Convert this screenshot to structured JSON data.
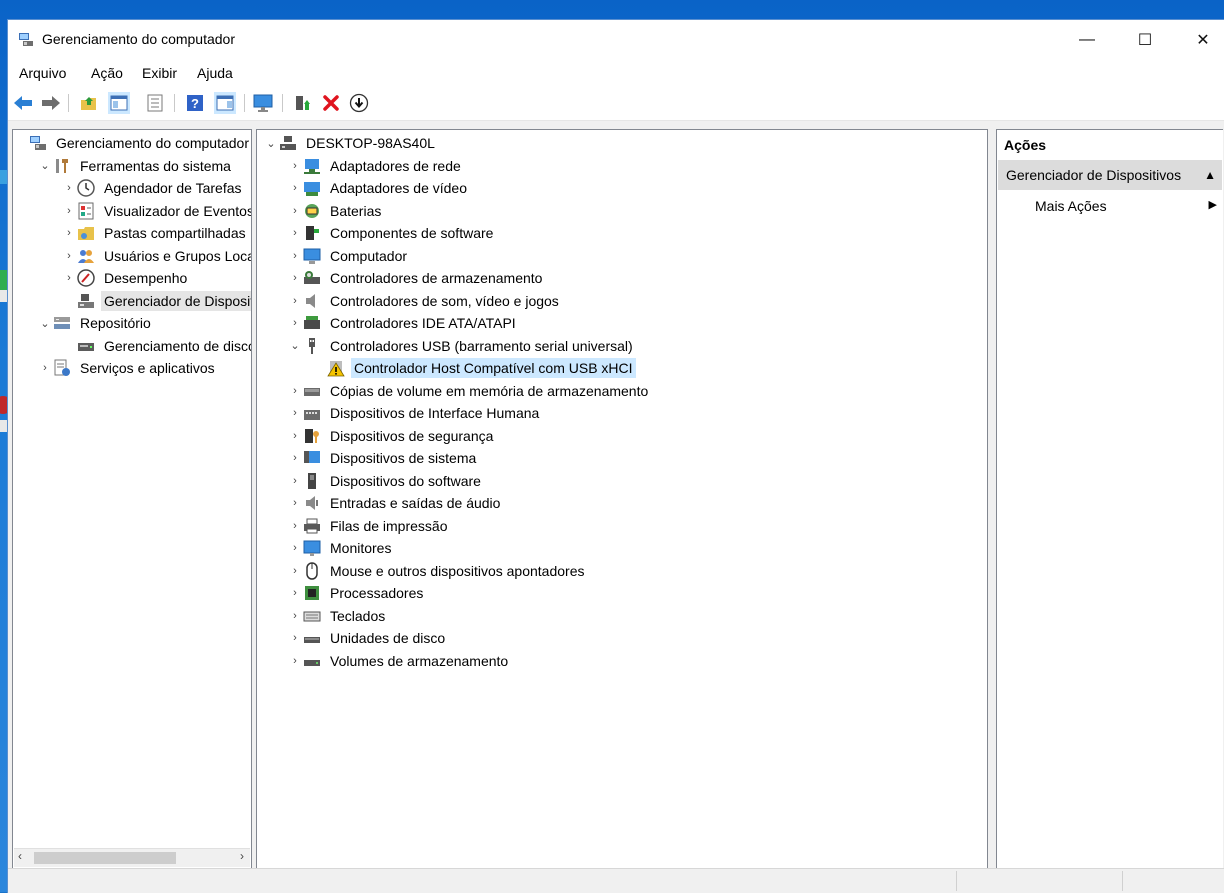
{
  "window": {
    "title": "Gerenciamento do computador",
    "controls": {
      "minimize": "—",
      "maximize": "☐",
      "close": "✕"
    }
  },
  "menu": [
    "Arquivo",
    "Ação",
    "Exibir",
    "Ajuda"
  ],
  "toolbar": [
    "back-icon",
    "forward-icon",
    "up-folder-icon",
    "show-hide-tree-icon",
    "properties-icon",
    "help-icon",
    "action-pane-icon",
    "monitor-icon",
    "enable-device-icon",
    "uninstall-icon",
    "update-driver-icon"
  ],
  "left_tree": [
    {
      "label": "Gerenciamento do computador",
      "expander": "",
      "icon": "computer-management-icon",
      "level": 0
    },
    {
      "label": "Ferramentas do sistema",
      "expander": "⌄",
      "icon": "tools-icon",
      "level": 1
    },
    {
      "label": "Agendador de Tarefas",
      "expander": "›",
      "icon": "clock-icon",
      "level": 2
    },
    {
      "label": "Visualizador de Eventos",
      "expander": "›",
      "icon": "event-viewer-icon",
      "level": 2
    },
    {
      "label": "Pastas compartilhadas",
      "expander": "›",
      "icon": "shared-folder-icon",
      "level": 2
    },
    {
      "label": "Usuários e Grupos Locai",
      "expander": "›",
      "icon": "users-icon",
      "level": 2
    },
    {
      "label": "Desempenho",
      "expander": "›",
      "icon": "performance-icon",
      "level": 2
    },
    {
      "label": "Gerenciador de Disposit",
      "expander": "",
      "icon": "device-manager-icon",
      "level": 2,
      "selected": true
    },
    {
      "label": "Repositório",
      "expander": "⌄",
      "icon": "storage-icon",
      "level": 1
    },
    {
      "label": "Gerenciamento de disco",
      "expander": "",
      "icon": "disk-management-icon",
      "level": 2
    },
    {
      "label": "Serviços e aplicativos",
      "expander": "›",
      "icon": "services-icon",
      "level": 1
    }
  ],
  "device_tree": [
    {
      "label": "DESKTOP-98AS40L",
      "expander": "⌄",
      "icon": "computer-root-icon",
      "level": 0
    },
    {
      "label": "Adaptadores de rede",
      "expander": "›",
      "icon": "network-adapter-icon",
      "level": 1
    },
    {
      "label": "Adaptadores de vídeo",
      "expander": "›",
      "icon": "display-adapter-icon",
      "level": 1
    },
    {
      "label": "Baterias",
      "expander": "›",
      "icon": "battery-icon",
      "level": 1
    },
    {
      "label": "Componentes de software",
      "expander": "›",
      "icon": "software-component-icon",
      "level": 1
    },
    {
      "label": "Computador",
      "expander": "›",
      "icon": "computer-icon",
      "level": 1
    },
    {
      "label": "Controladores de armazenamento",
      "expander": "›",
      "icon": "storage-controller-icon",
      "level": 1
    },
    {
      "label": "Controladores de som, vídeo e jogos",
      "expander": "›",
      "icon": "speaker-icon",
      "level": 1
    },
    {
      "label": "Controladores IDE ATA/ATAPI",
      "expander": "›",
      "icon": "ide-controller-icon",
      "level": 1
    },
    {
      "label": "Controladores USB (barramento serial universal)",
      "expander": "⌄",
      "icon": "usb-icon",
      "level": 1
    },
    {
      "label": "Controlador Host Compatível com USB xHCI",
      "expander": "",
      "icon": "warning-icon",
      "level": 2,
      "selected": true
    },
    {
      "label": "Cópias de volume em memória de armazenamento",
      "expander": "›",
      "icon": "drive-icon",
      "level": 1
    },
    {
      "label": "Dispositivos de Interface Humana",
      "expander": "›",
      "icon": "hid-icon",
      "level": 1
    },
    {
      "label": "Dispositivos de segurança",
      "expander": "›",
      "icon": "security-device-icon",
      "level": 1
    },
    {
      "label": "Dispositivos de sistema",
      "expander": "›",
      "icon": "system-device-icon",
      "level": 1
    },
    {
      "label": "Dispositivos do software",
      "expander": "›",
      "icon": "software-device-icon",
      "level": 1
    },
    {
      "label": "Entradas e saídas de áudio",
      "expander": "›",
      "icon": "audio-io-icon",
      "level": 1
    },
    {
      "label": "Filas de impressão",
      "expander": "›",
      "icon": "printer-icon",
      "level": 1
    },
    {
      "label": "Monitores",
      "expander": "›",
      "icon": "monitor-icon",
      "level": 1
    },
    {
      "label": "Mouse e outros dispositivos apontadores",
      "expander": "›",
      "icon": "mouse-icon",
      "level": 1
    },
    {
      "label": "Processadores",
      "expander": "›",
      "icon": "processor-icon",
      "level": 1
    },
    {
      "label": "Teclados",
      "expander": "›",
      "icon": "keyboard-icon",
      "level": 1
    },
    {
      "label": "Unidades de disco",
      "expander": "›",
      "icon": "disk-drive-icon",
      "level": 1
    },
    {
      "label": "Volumes de armazenamento",
      "expander": "›",
      "icon": "storage-volume-icon",
      "level": 1
    }
  ],
  "actions": {
    "header": "Ações",
    "section": "Gerenciador de Dispositivos",
    "section_arrow": "▲",
    "item": "Mais Ações",
    "item_arrow": "▶"
  },
  "colors": {
    "selection_blue": "#cce8ff",
    "selection_gray": "#e5e5e5",
    "warning_yellow": "#f5c400",
    "uninstall_red": "#e0141e"
  }
}
